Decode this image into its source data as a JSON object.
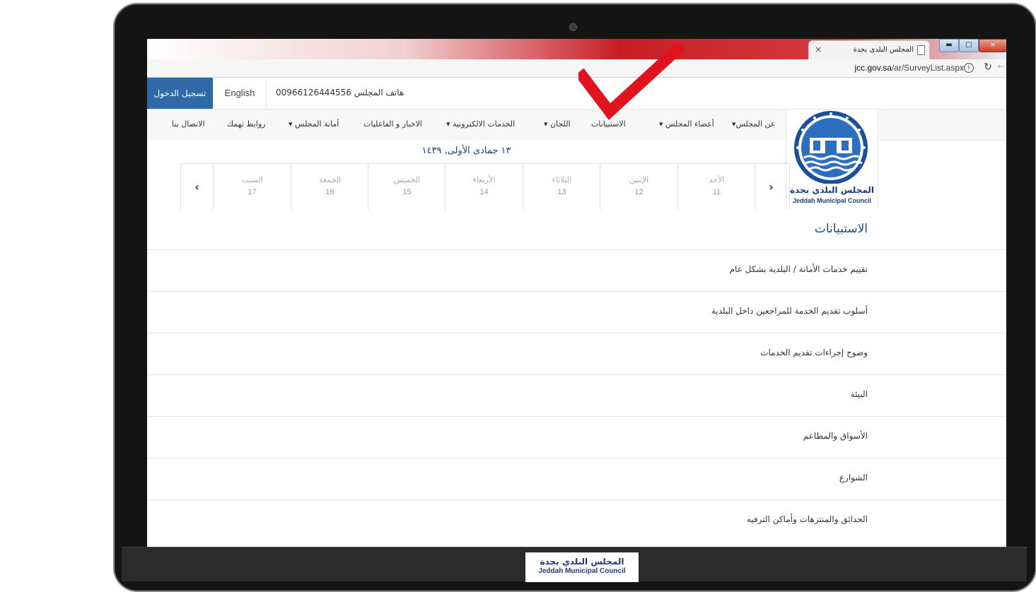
{
  "browser": {
    "tab_title": "المجلس البلدى بجدة",
    "tab_close": "×",
    "url_domain": "jcc.gov.sa",
    "url_path": "/ar/SurveyList.aspx",
    "window_controls": [
      "▬",
      "□",
      "×"
    ]
  },
  "topbar": {
    "login_label": "تسجيل الدخول",
    "language_label": "English",
    "phone_label": "هاتف المجلس",
    "phone_number": "00966126444556"
  },
  "nav": {
    "items": [
      "عن المجلس▾",
      "أعضاء المجلس ▾",
      "الاستبيانات",
      "اللجان ▾",
      "الخدمات الالكترونية ▾",
      "الاخبار و الفاعليات",
      "أمانة المجلس ▾",
      "روابط تهمك",
      "الاتصال بنا"
    ]
  },
  "logo": {
    "title_ar": "المجلس البلدي بجدة",
    "title_en": "Jeddah Municipal Council"
  },
  "calendar": {
    "hijri_date": "١٣ جمادى الأولى, ١٤٣٩",
    "prev_arrow": "‹",
    "next_arrow": "›",
    "days": [
      {
        "name": "الأحد",
        "num": "11"
      },
      {
        "name": "الإثنين",
        "num": "12"
      },
      {
        "name": "الثلاثاء",
        "num": "13"
      },
      {
        "name": "الأربعاء",
        "num": "14"
      },
      {
        "name": "الخميس",
        "num": "15"
      },
      {
        "name": "الجمعة",
        "num": "16"
      },
      {
        "name": "السبت",
        "num": "17"
      }
    ]
  },
  "page": {
    "title": "الاستبيانات",
    "surveys": [
      "تقييم خدمات الأمانة / البلدية بشكل عام",
      "أسلوب تقديم الخدمة للمراجعين داخل البلدية",
      "وضوح إجراءات تقديم الخدمات",
      "البيئة",
      "الأسواق والمطاعم",
      "الشوارع",
      "الحدائق والمنتزهات وأماكن الترفيه"
    ]
  },
  "colors": {
    "accent": "#2f6aa6",
    "brand_navy": "#1b3c7a",
    "checkmark": "#e0141e"
  }
}
